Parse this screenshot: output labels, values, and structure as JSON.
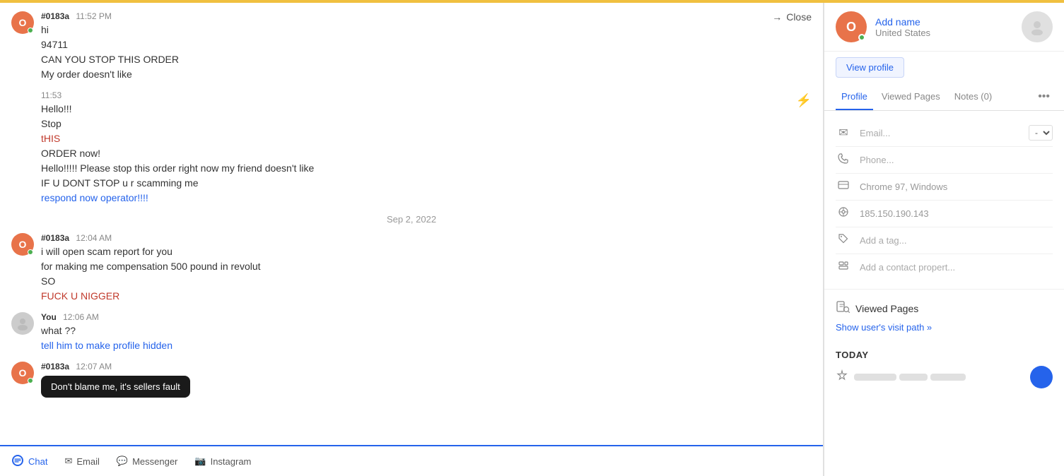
{
  "topBar": {},
  "chat": {
    "closeLabel": "Close",
    "messages": [
      {
        "sender": "#0183a",
        "time": "11:52 PM",
        "lines": [
          {
            "text": "hi",
            "style": "normal"
          },
          {
            "text": "94711",
            "style": "normal"
          },
          {
            "text": "CAN YOU STOP THIS ORDER",
            "style": "normal"
          },
          {
            "text": "My order doesn't like",
            "style": "normal"
          }
        ],
        "avatar": "0",
        "type": "visitor"
      },
      {
        "sender": "",
        "time": "11:53",
        "lines": [
          {
            "text": "Hello!!!",
            "style": "normal"
          },
          {
            "text": "Stop",
            "style": "normal"
          },
          {
            "text": "tHIS",
            "style": "orange"
          },
          {
            "text": "ORDER now!",
            "style": "normal"
          },
          {
            "text": "Hello!!!!! Please stop this order right now my friend doesn't like",
            "style": "normal"
          },
          {
            "text": "IF U DONT STOP u r scamming me",
            "style": "normal"
          },
          {
            "text": "respond now operator!!!!",
            "style": "blue"
          }
        ],
        "avatar": "0",
        "type": "visitor-continued"
      }
    ],
    "dateDivider": "Sep 2, 2022",
    "messages2": [
      {
        "sender": "#0183a",
        "time": "12:04 AM",
        "lines": [
          {
            "text": "i will open scam report for you",
            "style": "normal"
          },
          {
            "text": "for making me compensation 500 pound in revolut",
            "style": "normal"
          },
          {
            "text": "SO",
            "style": "normal"
          },
          {
            "text": "FUCK U NIGGER",
            "style": "angry"
          }
        ],
        "avatar": "0",
        "type": "visitor"
      },
      {
        "sender": "You",
        "time": "12:06 AM",
        "lines": [
          {
            "text": "what ??",
            "style": "normal"
          },
          {
            "text": "tell him to make profile hidden",
            "style": "blue"
          }
        ],
        "avatar": "agent",
        "type": "agent"
      },
      {
        "sender": "#0183a",
        "time": "12:07 AM",
        "lines": [],
        "avatar": "0",
        "type": "visitor-image",
        "tooltipText": "Don't blame me, it's sellers fault"
      }
    ]
  },
  "toolbar": {
    "items": [
      {
        "label": "Chat",
        "icon": "💬",
        "active": true
      },
      {
        "label": "Email",
        "icon": "✉",
        "active": false
      },
      {
        "label": "Messenger",
        "icon": "💬",
        "active": false
      },
      {
        "label": "Instagram",
        "icon": "📷",
        "active": false
      }
    ]
  },
  "sidebar": {
    "user": {
      "avatar": "O",
      "name": "Add name",
      "country": "United States"
    },
    "viewProfileLabel": "View profile",
    "tabs": [
      {
        "label": "Profile",
        "active": true
      },
      {
        "label": "Viewed Pages",
        "active": false
      },
      {
        "label": "Notes (0)",
        "active": false
      }
    ],
    "moreIcon": "•••",
    "profile": {
      "email": {
        "icon": "✉",
        "value": "Email..."
      },
      "emailDropdown": "-",
      "phone": {
        "icon": "📞",
        "value": "Phone..."
      },
      "browser": {
        "icon": "💻",
        "value": "Chrome 97, Windows"
      },
      "ip": {
        "icon": "🎯",
        "value": "185.150.190.143"
      },
      "tag": {
        "icon": "🏷",
        "value": "Add a tag..."
      },
      "property": {
        "icon": "📁",
        "value": "Add a contact propert..."
      }
    },
    "viewedPages": {
      "title": "Viewed Pages",
      "visitPathLabel": "Show user's visit path »"
    },
    "today": {
      "label": "TODAY"
    }
  }
}
